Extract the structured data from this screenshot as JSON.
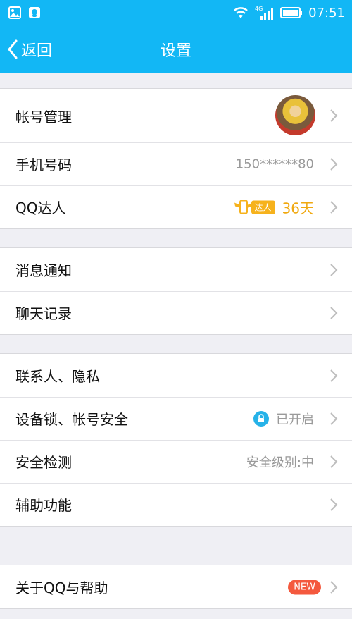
{
  "status_bar": {
    "network": "4G",
    "time": "07:51"
  },
  "nav": {
    "back_label": "返回",
    "title": "设置"
  },
  "group1": [
    {
      "label": "帐号管理",
      "value": ""
    },
    {
      "label": "手机号码",
      "value": "150******80"
    },
    {
      "label": "QQ达人",
      "value": "36天",
      "badge": "达人"
    }
  ],
  "group2": [
    {
      "label": "消息通知"
    },
    {
      "label": "聊天记录"
    }
  ],
  "group3": [
    {
      "label": "联系人、隐私"
    },
    {
      "label": "设备锁、帐号安全",
      "value": "已开启"
    },
    {
      "label": "安全检测",
      "value": "安全级别:中"
    },
    {
      "label": "辅助功能"
    }
  ],
  "group4": [
    {
      "label": "关于QQ与帮助",
      "badge": "NEW"
    }
  ],
  "colors": {
    "accent": "#12b7f5",
    "gold": "#f0a80f",
    "new_badge": "#f4593e"
  }
}
